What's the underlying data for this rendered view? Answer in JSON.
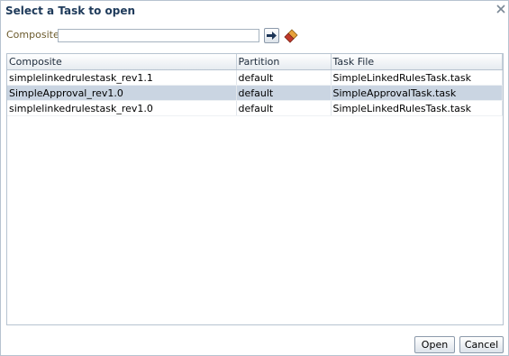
{
  "dialog": {
    "title": "Select a Task to open",
    "close_icon": "close-icon"
  },
  "search": {
    "label": "Composite",
    "value": "",
    "placeholder": "",
    "go_icon": "arrow-right-icon",
    "clear_icon": "eraser-icon"
  },
  "table": {
    "headers": [
      "Composite",
      "Partition",
      "Task File"
    ],
    "rows": [
      {
        "composite": "simplelinkedrulestask_rev1.1",
        "partition": "default",
        "task_file": "SimpleLinkedRulesTask.task",
        "selected": false
      },
      {
        "composite": "SimpleApproval_rev1.0",
        "partition": "default",
        "task_file": "SimpleApprovalTask.task",
        "selected": true
      },
      {
        "composite": "simplelinkedrulestask_rev1.0",
        "partition": "default",
        "task_file": "SimpleLinkedRulesTask.task",
        "selected": false
      }
    ]
  },
  "footer": {
    "open_label": "Open",
    "cancel_label": "Cancel"
  },
  "colors": {
    "title": "#1e3a5a",
    "label": "#6b5a2c",
    "selected_row": "#cad5e2",
    "border": "#b7c3d0"
  }
}
